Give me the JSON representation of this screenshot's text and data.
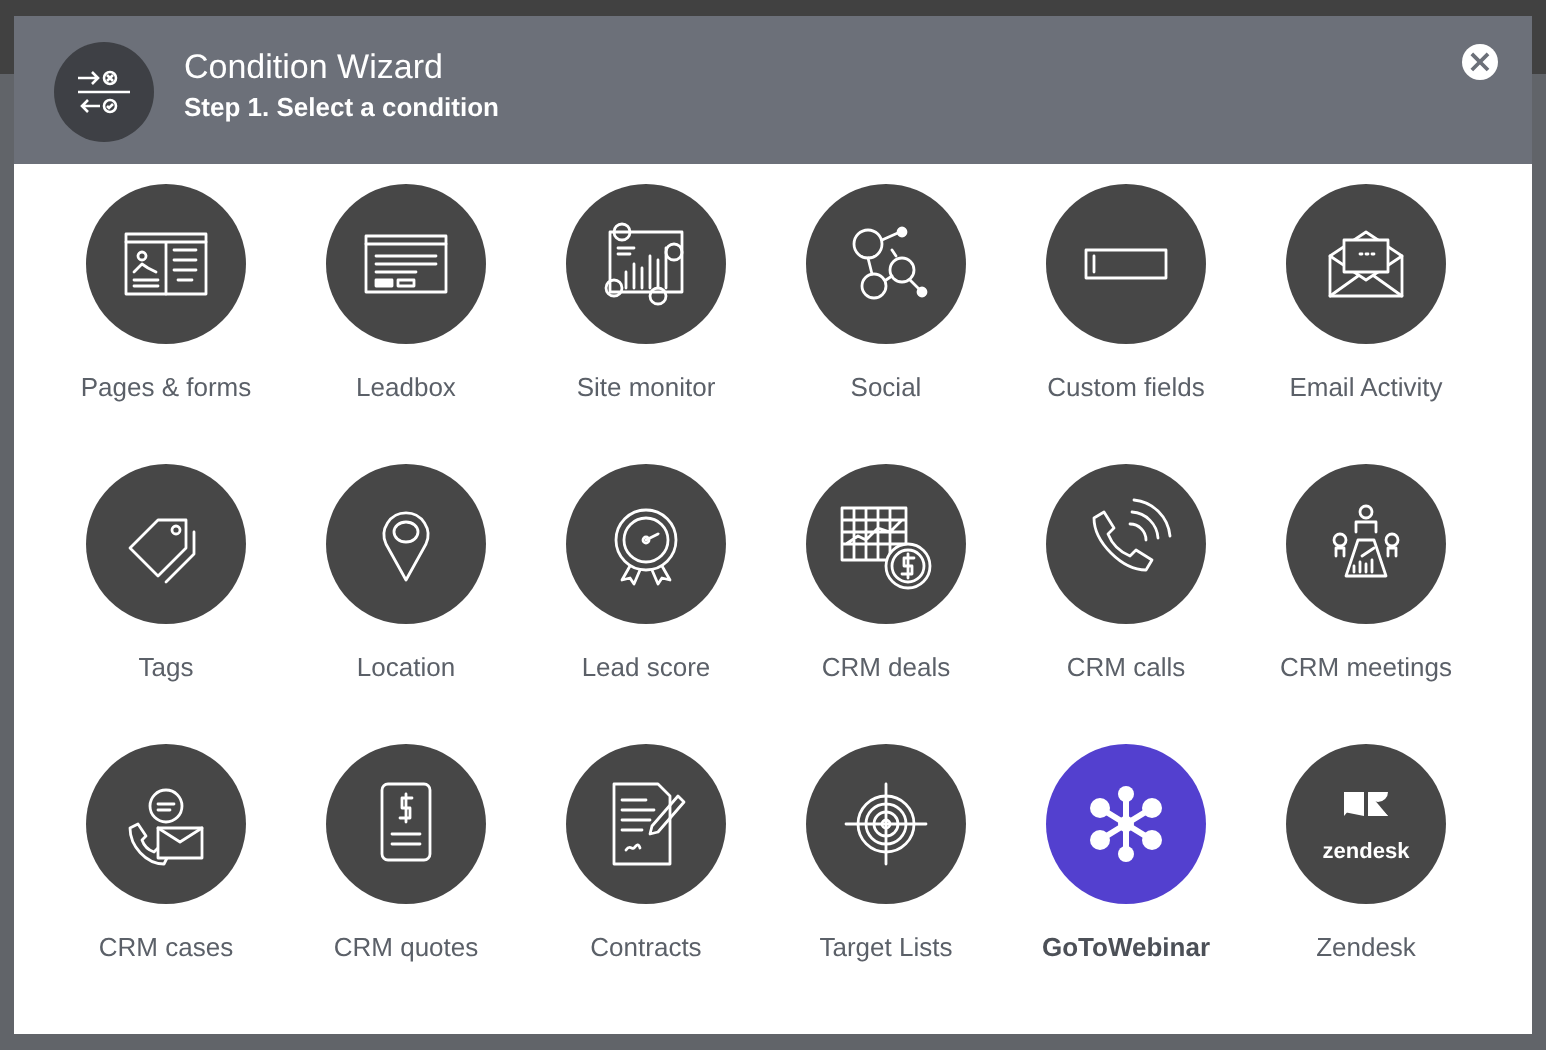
{
  "window": {
    "title": "Condition Wizard",
    "subtitle": "Step 1. Select a condition",
    "close": "×"
  },
  "conditions": [
    {
      "label": "Pages & forms",
      "kind": "pages",
      "color": "#474747",
      "emphasized": false
    },
    {
      "label": "Leadbox",
      "kind": "leadbox",
      "color": "#474747",
      "emphasized": false
    },
    {
      "label": "Site monitor",
      "kind": "monitor",
      "color": "#474747",
      "emphasized": false
    },
    {
      "label": "Social",
      "kind": "social",
      "color": "#474747",
      "emphasized": false
    },
    {
      "label": "Custom fields",
      "kind": "field",
      "color": "#474747",
      "emphasized": false
    },
    {
      "label": "Email Activity",
      "kind": "email",
      "color": "#474747",
      "emphasized": false
    },
    {
      "label": "Tags",
      "kind": "tag",
      "color": "#474747",
      "emphasized": false
    },
    {
      "label": "Location",
      "kind": "location",
      "color": "#474747",
      "emphasized": false
    },
    {
      "label": "Lead score",
      "kind": "score",
      "color": "#474747",
      "emphasized": false
    },
    {
      "label": "CRM deals",
      "kind": "deals",
      "color": "#474747",
      "emphasized": false
    },
    {
      "label": "CRM calls",
      "kind": "calls",
      "color": "#474747",
      "emphasized": false
    },
    {
      "label": "CRM meetings",
      "kind": "meetings",
      "color": "#474747",
      "emphasized": false
    },
    {
      "label": "CRM cases",
      "kind": "cases",
      "color": "#474747",
      "emphasized": false
    },
    {
      "label": "CRM quotes",
      "kind": "quotes",
      "color": "#474747",
      "emphasized": false
    },
    {
      "label": "Contracts",
      "kind": "contracts",
      "color": "#474747",
      "emphasized": false
    },
    {
      "label": "Target Lists",
      "kind": "target",
      "color": "#474747",
      "emphasized": false
    },
    {
      "label": "GoToWebinar",
      "kind": "webinar",
      "color": "#5340cf",
      "emphasized": true
    },
    {
      "label": "Zendesk",
      "kind": "zendesk",
      "color": "#474747",
      "emphasized": false,
      "logo_text": "zendesk"
    }
  ]
}
